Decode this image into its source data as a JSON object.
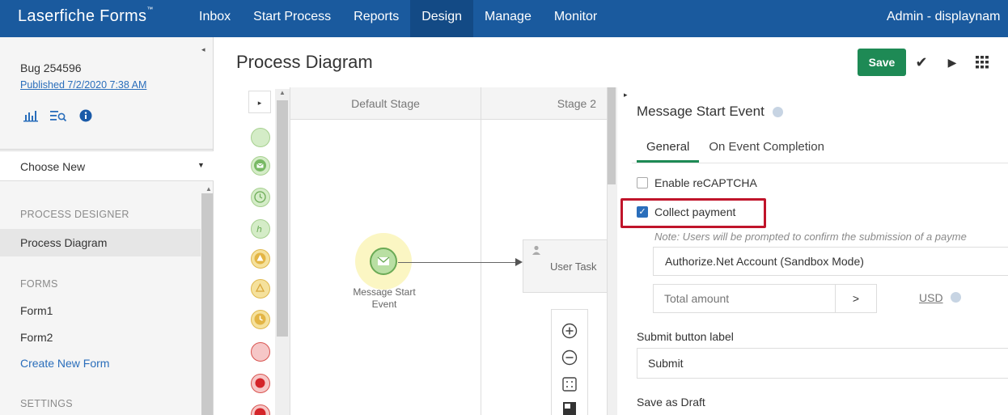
{
  "app": {
    "brand": "Laserfiche Forms",
    "brand_mark": "™",
    "user_label": "Admin - displaynam"
  },
  "nav": {
    "items": [
      {
        "label": "Inbox"
      },
      {
        "label": "Start Process"
      },
      {
        "label": "Reports"
      },
      {
        "label": "Design"
      },
      {
        "label": "Manage"
      },
      {
        "label": "Monitor"
      }
    ],
    "active": "Design"
  },
  "sidebar": {
    "project_title": "Bug 254596",
    "published": "Published 7/2/2020 7:38 AM",
    "icons": [
      "bar-chart-icon",
      "list-search-icon",
      "info-icon"
    ],
    "choose_new": "Choose New",
    "section_process_designer": "PROCESS DESIGNER",
    "process_diagram": "Process Diagram",
    "section_forms": "FORMS",
    "form1": "Form1",
    "form2": "Form2",
    "create_new_form": "Create New Form",
    "section_settings": "SETTINGS"
  },
  "main": {
    "title": "Process Diagram",
    "save_label": "Save"
  },
  "canvas": {
    "lanes": [
      {
        "label": "Default Stage"
      },
      {
        "label": "Stage 2"
      }
    ],
    "start_event_label": "Message Start Event",
    "user_task_label": "User Task"
  },
  "palette": {
    "colors": {
      "green": "#d4ecc7",
      "yellow": "#f5e19c",
      "red": "#f6c7c7"
    }
  },
  "props": {
    "title": "Message Start Event",
    "tabs": [
      "General",
      "On Event Completion"
    ],
    "active_tab": "General",
    "enable_recaptcha": "Enable reCAPTCHA",
    "collect_payment": "Collect payment",
    "collect_payment_checked": true,
    "note": "Note: Users will be prompted to confirm the submission of a payme",
    "account_select": "Authorize.Net Account (Sandbox Mode)",
    "amount_placeholder": "Total amount",
    "amount_btn": ">",
    "currency": "USD",
    "submit_label_heading": "Submit button label",
    "submit_label_value": "Submit",
    "save_as_draft": "Save as Draft",
    "highlight_color": "#c0142a",
    "accent_color": "#1e8a55"
  }
}
